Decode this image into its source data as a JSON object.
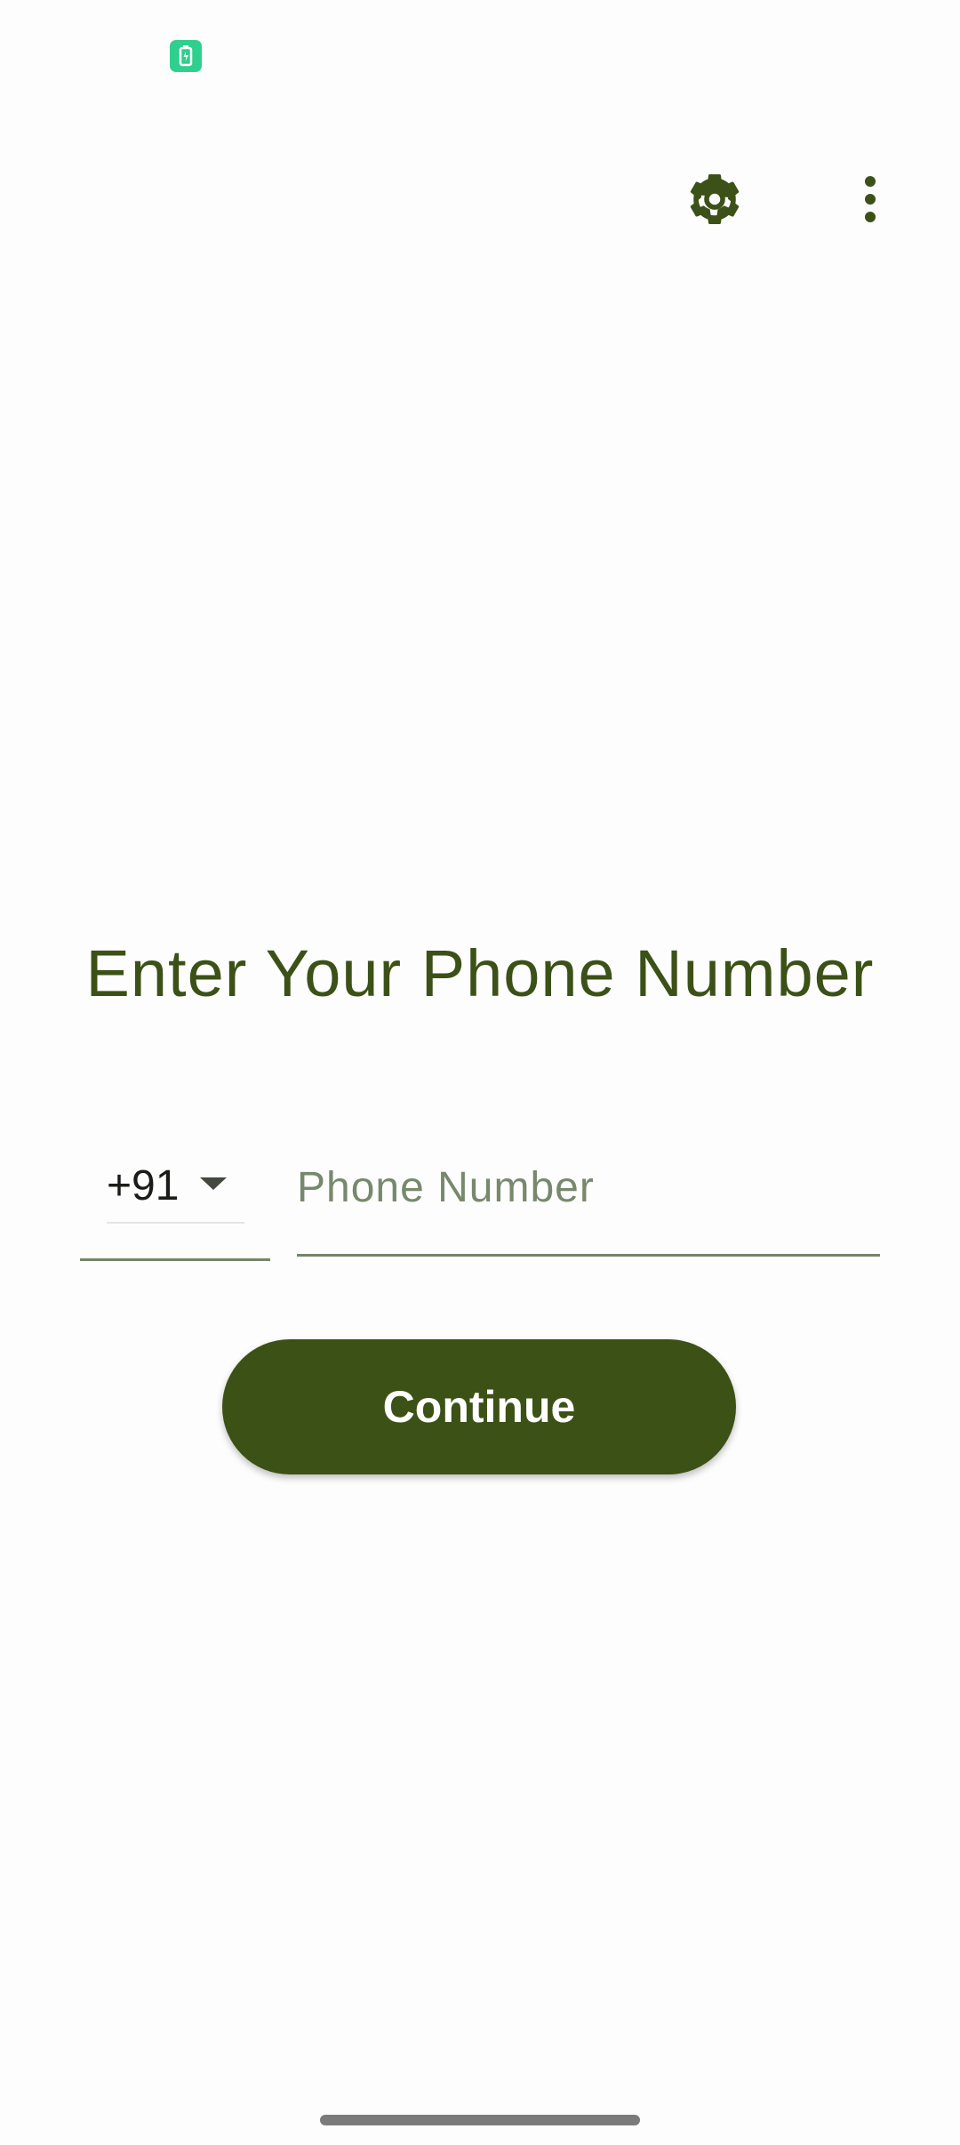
{
  "status_bar": {
    "battery_icon": "battery-saver-icon",
    "battery_color": "#2fcf8e"
  },
  "toolbar": {
    "settings_icon": "gear-icon",
    "more_icon": "more-vert-icon"
  },
  "main": {
    "title": "Enter Your Phone Number",
    "country_code": "+91",
    "phone_value": "",
    "phone_placeholder": "Phone Number",
    "continue_label": "Continue"
  },
  "colors": {
    "primary": "#3c5115",
    "title_text": "#3b5117",
    "placeholder": "#77896d",
    "underline": "#74866a",
    "background": "#fefdfd"
  }
}
